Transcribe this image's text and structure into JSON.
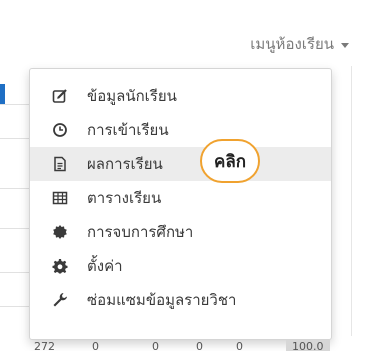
{
  "menu": {
    "toggle_label": "เมนูห้องเรียน",
    "items": [
      {
        "label": "ข้อมูลนักเรียน",
        "icon": "edit-icon"
      },
      {
        "label": "การเข้าเรียน",
        "icon": "clock-icon"
      },
      {
        "label": "ผลการเรียน",
        "icon": "document-icon"
      },
      {
        "label": "ตารางเรียน",
        "icon": "table-icon"
      },
      {
        "label": "การจบการศึกษา",
        "icon": "badge-icon"
      },
      {
        "label": "ตั้งค่า",
        "icon": "gear-icon"
      },
      {
        "label": "ซ่อมแซมข้อมูลรายวิชา",
        "icon": "wrench-icon"
      }
    ],
    "active_index": 2
  },
  "callout": {
    "text": "คลิก",
    "color": "#f0a22f"
  },
  "background_row": {
    "cells": [
      "272",
      "0",
      "0",
      "0",
      "0",
      "100.0"
    ]
  },
  "colors": {
    "accent": "#1f6fc4",
    "active_bg": "#ececec"
  }
}
